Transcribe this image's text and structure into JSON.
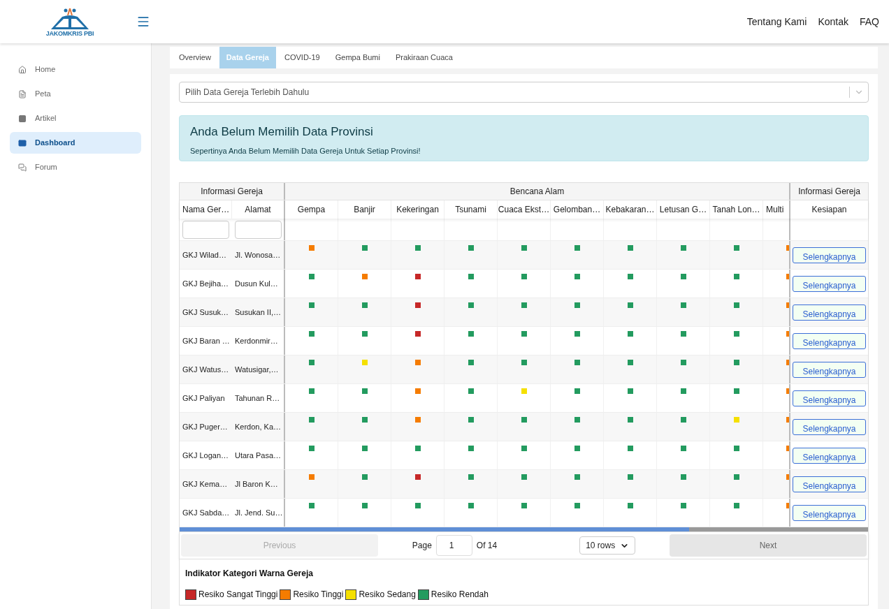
{
  "brand": {
    "name": "JAKOMKRIS PBI"
  },
  "top_nav": [
    "Tentang Kami",
    "Kontak",
    "FAQ"
  ],
  "sidebar": {
    "items": [
      {
        "label": "Home",
        "selected": false
      },
      {
        "label": "Peta",
        "selected": false
      },
      {
        "label": "Artikel",
        "selected": false
      },
      {
        "label": "Dashboard",
        "selected": true
      },
      {
        "label": "Forum",
        "selected": false
      }
    ]
  },
  "tabs": [
    {
      "label": "Overview",
      "selected": false
    },
    {
      "label": "Data Gereja",
      "selected": true
    },
    {
      "label": "COVID-19",
      "selected": false
    },
    {
      "label": "Gempa Bumi",
      "selected": false
    },
    {
      "label": "Prakiraan Cuaca",
      "selected": false
    }
  ],
  "select": {
    "placeholder": "Pilih Data Gereja Terlebih Dahulu"
  },
  "alert": {
    "title": "Anda Belum Memilih Data Provinsi",
    "message": "Sepertinya Anda Belum Memilih Data Gereja Untuk Setiap Provinsi!"
  },
  "table": {
    "groups": [
      "Informasi Gereja",
      "Bencana Alam",
      "Informasi Gereja"
    ],
    "info_columns": [
      "Nama Ger…",
      "Alamat"
    ],
    "hazard_columns": [
      "Gempa",
      "Banjir",
      "Kekeringan",
      "Tsunami",
      "Cuaca Ekst…",
      "Gelomban…",
      "Kebakaran…",
      "Letusan G…",
      "Tanah Lon…",
      "Multi"
    ],
    "action_column": "Kesiapan",
    "rows": [
      {
        "name": "GKJ Wilad…",
        "address": "Jl. Wonosa…",
        "risks": [
          {
            "color": "#f57c00"
          },
          {
            "color": "#239b5f"
          },
          {
            "color": "#239b5f"
          },
          {
            "color": "#239b5f"
          },
          {
            "color": "#239b5f"
          },
          {
            "color": "#239b5f"
          },
          {
            "color": "#239b5f"
          },
          {
            "color": "#239b5f"
          },
          {
            "color": "#239b5f"
          },
          {
            "color": "#f57c00"
          }
        ],
        "action": "Selengkapnya"
      },
      {
        "name": "GKJ Bejiha…",
        "address": "Dusun Kul…",
        "risks": [
          {
            "color": "#239b5f"
          },
          {
            "color": "#f57c00"
          },
          {
            "color": "#c62828"
          },
          {
            "color": "#239b5f"
          },
          {
            "color": "#239b5f"
          },
          {
            "color": "#239b5f"
          },
          {
            "color": "#239b5f"
          },
          {
            "color": "#239b5f"
          },
          {
            "color": "#239b5f"
          },
          {
            "color": "#f57c00"
          }
        ],
        "action": "Selengkapnya"
      },
      {
        "name": "GKJ Susuk…",
        "address": "Susukan II,…",
        "risks": [
          {
            "color": "#239b5f"
          },
          {
            "color": "#239b5f"
          },
          {
            "color": "#c62828"
          },
          {
            "color": "#239b5f"
          },
          {
            "color": "#239b5f"
          },
          {
            "color": "#239b5f"
          },
          {
            "color": "#239b5f"
          },
          {
            "color": "#239b5f"
          },
          {
            "color": "#239b5f"
          },
          {
            "color": "#f57c00"
          }
        ],
        "action": "Selengkapnya"
      },
      {
        "name": "GKJ Baran …",
        "address": "Kerdonmir…",
        "risks": [
          {
            "color": "#239b5f"
          },
          {
            "color": "#239b5f"
          },
          {
            "color": "#c62828"
          },
          {
            "color": "#239b5f"
          },
          {
            "color": "#239b5f"
          },
          {
            "color": "#239b5f"
          },
          {
            "color": "#239b5f"
          },
          {
            "color": "#239b5f"
          },
          {
            "color": "#239b5f"
          },
          {
            "color": "#f57c00"
          }
        ],
        "action": "Selengkapnya"
      },
      {
        "name": "GKJ Watus…",
        "address": "Watusigar,…",
        "risks": [
          {
            "color": "#239b5f"
          },
          {
            "color": "#f5e000"
          },
          {
            "color": "#f57c00"
          },
          {
            "color": "#239b5f"
          },
          {
            "color": "#239b5f"
          },
          {
            "color": "#239b5f"
          },
          {
            "color": "#239b5f"
          },
          {
            "color": "#239b5f"
          },
          {
            "color": "#239b5f"
          },
          {
            "color": "#f57c00"
          }
        ],
        "action": "Selengkapnya"
      },
      {
        "name": "GKJ Paliyan",
        "address": "Tahunan R…",
        "risks": [
          {
            "color": "#239b5f"
          },
          {
            "color": "#239b5f"
          },
          {
            "color": "#f57c00"
          },
          {
            "color": "#239b5f"
          },
          {
            "color": "#f5e000"
          },
          {
            "color": "#239b5f"
          },
          {
            "color": "#239b5f"
          },
          {
            "color": "#239b5f"
          },
          {
            "color": "#239b5f"
          },
          {
            "color": "#f57c00"
          }
        ],
        "action": "Selengkapnya"
      },
      {
        "name": "GKJ Puger…",
        "address": "Kerdon, Ka…",
        "risks": [
          {
            "color": "#239b5f"
          },
          {
            "color": "#239b5f"
          },
          {
            "color": "#f57c00"
          },
          {
            "color": "#239b5f"
          },
          {
            "color": "#239b5f"
          },
          {
            "color": "#239b5f"
          },
          {
            "color": "#239b5f"
          },
          {
            "color": "#239b5f"
          },
          {
            "color": "#f5e000"
          },
          {
            "color": "#f57c00"
          }
        ],
        "action": "Selengkapnya"
      },
      {
        "name": "GKJ Logan…",
        "address": "Utara Pasa…",
        "risks": [
          {
            "color": "#239b5f"
          },
          {
            "color": "#239b5f"
          },
          {
            "color": "#239b5f"
          },
          {
            "color": "#239b5f"
          },
          {
            "color": "#239b5f"
          },
          {
            "color": "#239b5f"
          },
          {
            "color": "#239b5f"
          },
          {
            "color": "#239b5f"
          },
          {
            "color": "#239b5f"
          },
          {
            "color": "#f57c00"
          }
        ],
        "action": "Selengkapnya"
      },
      {
        "name": "GKJ Kema…",
        "address": "Jl Baron K…",
        "risks": [
          {
            "color": "#f57c00"
          },
          {
            "color": "#239b5f"
          },
          {
            "color": "#c62828"
          },
          {
            "color": "#239b5f"
          },
          {
            "color": "#239b5f"
          },
          {
            "color": "#239b5f"
          },
          {
            "color": "#239b5f"
          },
          {
            "color": "#239b5f"
          },
          {
            "color": "#239b5f"
          },
          {
            "color": "#f57c00"
          }
        ],
        "action": "Selengkapnya"
      },
      {
        "name": "GKJ Sabda…",
        "address": "Jl. Jend. Su…",
        "risks": [
          {
            "color": "#239b5f"
          },
          {
            "color": "#239b5f"
          },
          {
            "color": "#239b5f"
          },
          {
            "color": "#239b5f"
          },
          {
            "color": "#239b5f"
          },
          {
            "color": "#239b5f"
          },
          {
            "color": "#239b5f"
          },
          {
            "color": "#239b5f"
          },
          {
            "color": "#239b5f"
          },
          {
            "color": "#f57c00"
          }
        ],
        "action": "Selengkapnya"
      }
    ]
  },
  "pagination": {
    "previous": "Previous",
    "page_label": "Page",
    "page": "1",
    "of": "Of 14",
    "rows": "10 rows",
    "next": "Next"
  },
  "legend": {
    "title": "Indikator Kategori Warna Gereja",
    "items": [
      {
        "label": "Resiko Sangat Tinggi",
        "color": "#c62828"
      },
      {
        "label": "Resiko Tinggi",
        "color": "#f57c00"
      },
      {
        "label": "Resiko Sedang",
        "color": "#f5e000"
      },
      {
        "label": "Resiko Rendah",
        "color": "#239b5f"
      }
    ]
  }
}
